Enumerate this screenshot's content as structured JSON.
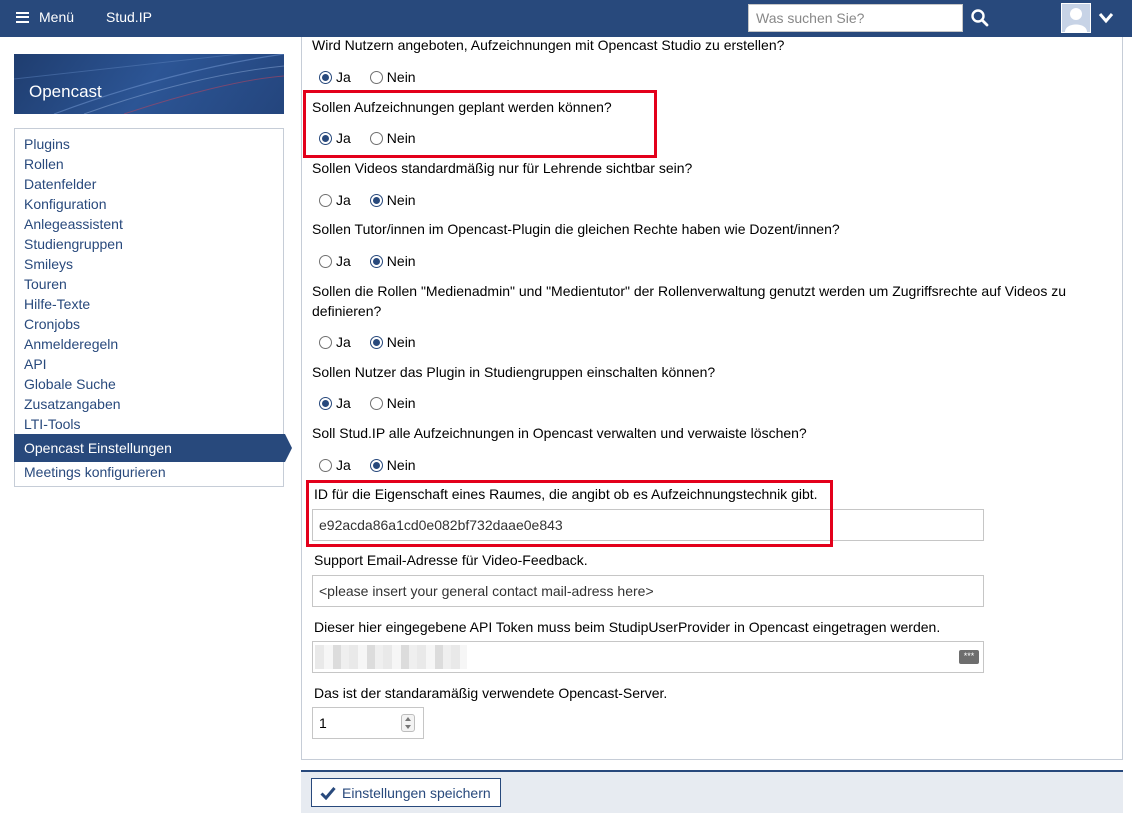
{
  "topbar": {
    "menu_label": "Menü",
    "brand": "Stud.IP",
    "search_placeholder": "Was suchen Sie?"
  },
  "sidebar": {
    "title": "Opencast",
    "items": [
      "Plugins",
      "Rollen",
      "Datenfelder",
      "Konfiguration",
      "Anlegeassistent",
      "Studiengruppen",
      "Smileys",
      "Touren",
      "Hilfe-Texte",
      "Cronjobs",
      "Anmelderegeln",
      "API",
      "Globale Suche",
      "Zusatzangaben",
      "LTI-Tools",
      "Opencast Einstellungen",
      "Meetings konfigurieren"
    ],
    "active_item": "Opencast Einstellungen"
  },
  "form": {
    "yes_label": "Ja",
    "no_label": "Nein",
    "questions": [
      {
        "text": "Wird Nutzern angeboten, Aufzeichnungen mit Opencast Studio zu erstellen?",
        "selected": "Ja"
      },
      {
        "text": "Sollen Aufzeichnungen geplant werden können?",
        "selected": "Ja"
      },
      {
        "text": "Sollen Videos standardmäßig nur für Lehrende sichtbar sein?",
        "selected": "Nein"
      },
      {
        "text": "Sollen Tutor/innen im Opencast-Plugin die gleichen Rechte haben wie Dozent/innen?",
        "selected": "Nein"
      },
      {
        "text": "Sollen die Rollen \"Medienadmin\" und \"Medientutor\" der Rollenverwaltung genutzt werden um Zugriffsrechte auf Videos zu definieren?",
        "selected": "Nein"
      },
      {
        "text": "Sollen Nutzer das Plugin in Studiengruppen einschalten können?",
        "selected": "Ja"
      },
      {
        "text": "Soll Stud.IP alle Aufzeichnungen in Opencast verwalten und verwaiste löschen?",
        "selected": "Nein"
      }
    ],
    "room_id_label": "ID für die Eigenschaft eines Raumes, die angibt ob es Aufzeichnungstechnik gibt.",
    "room_id_value": "e92acda86a1cd0e082bf732daae0e843",
    "email_label": "Support Email-Adresse für Video-Feedback.",
    "email_value": "<please insert your general contact mail-adress here>",
    "token_label": "Dieser hier eingegebene API Token muss beim StudipUserProvider in Opencast eingetragen werden.",
    "token_icon_text": "***",
    "server_label": "Das ist der standaramäßig verwendete Opencast-Server.",
    "server_value": "1"
  },
  "footer": {
    "save_label": "Einstellungen speichern"
  },
  "colors": {
    "brand": "#28497c",
    "highlight": "#e3001b"
  }
}
